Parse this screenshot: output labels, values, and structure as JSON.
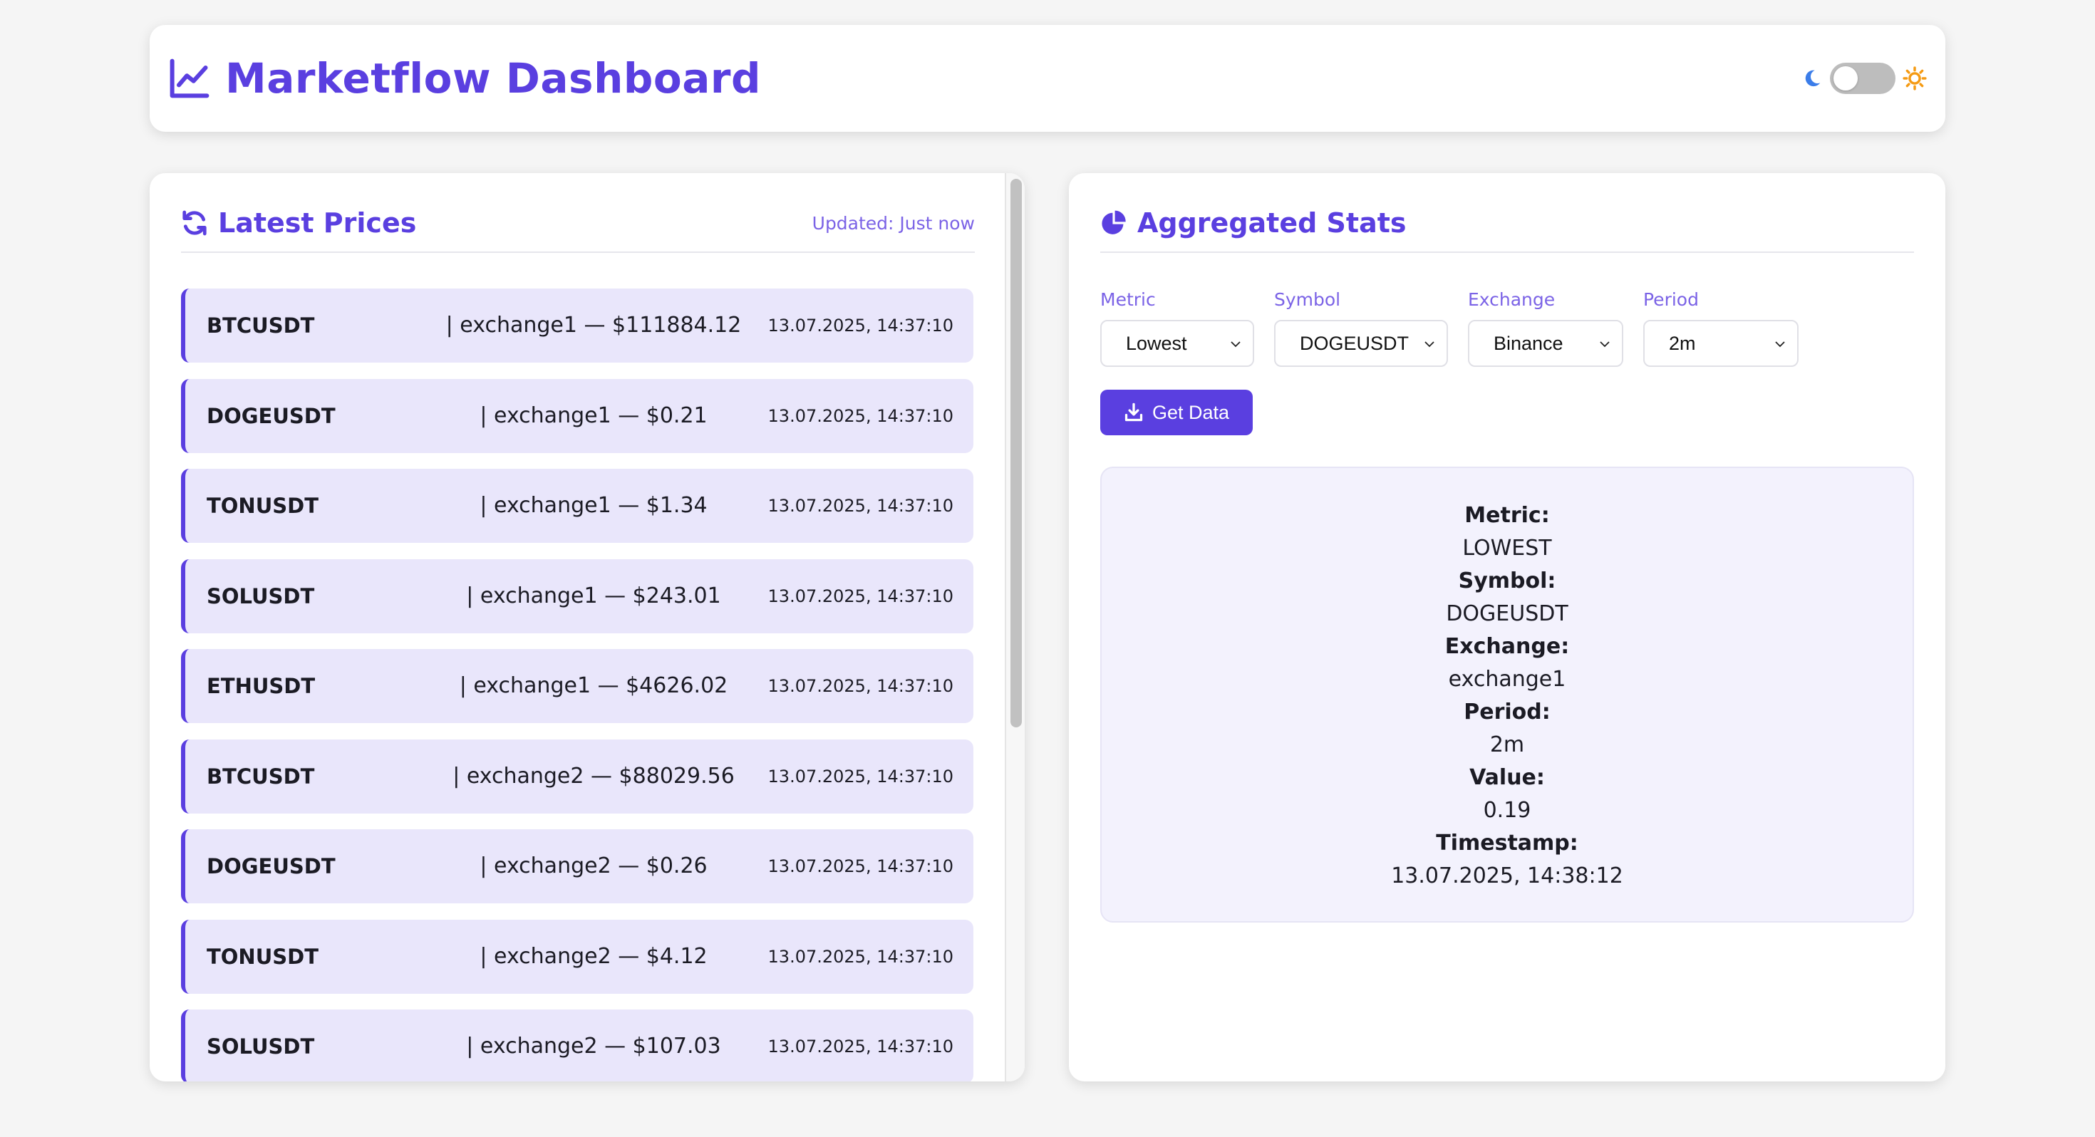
{
  "header": {
    "title": "Marketflow Dashboard",
    "title_icon": "chart-line-icon",
    "theme_toggle": {
      "state": "off",
      "left_icon": "moon-icon",
      "right_icon": "sun-icon"
    }
  },
  "colors": {
    "accent": "#5a3fe0",
    "accent_light": "#7b63e6",
    "row_bg": "#e9e6fb",
    "page_bg": "#f5f5f5",
    "sun": "#f59a12",
    "moon": "#3b7de9"
  },
  "latest_prices": {
    "title": "Latest Prices",
    "icon": "refresh-icon",
    "updated": "Updated: Just now",
    "rows": [
      {
        "symbol": "BTCUSDT",
        "info": "| exchange1 — $111884.12",
        "timestamp": "13.07.2025, 14:37:10"
      },
      {
        "symbol": "DOGEUSDT",
        "info": "| exchange1 — $0.21",
        "timestamp": "13.07.2025, 14:37:10"
      },
      {
        "symbol": "TONUSDT",
        "info": "| exchange1 — $1.34",
        "timestamp": "13.07.2025, 14:37:10"
      },
      {
        "symbol": "SOLUSDT",
        "info": "| exchange1 — $243.01",
        "timestamp": "13.07.2025, 14:37:10"
      },
      {
        "symbol": "ETHUSDT",
        "info": "| exchange1 — $4626.02",
        "timestamp": "13.07.2025, 14:37:10"
      },
      {
        "symbol": "BTCUSDT",
        "info": "| exchange2 — $88029.56",
        "timestamp": "13.07.2025, 14:37:10"
      },
      {
        "symbol": "DOGEUSDT",
        "info": "| exchange2 — $0.26",
        "timestamp": "13.07.2025, 14:37:10"
      },
      {
        "symbol": "TONUSDT",
        "info": "| exchange2 — $4.12",
        "timestamp": "13.07.2025, 14:37:10"
      },
      {
        "symbol": "SOLUSDT",
        "info": "| exchange2 — $107.03",
        "timestamp": "13.07.2025, 14:37:10"
      }
    ]
  },
  "aggregated": {
    "title": "Aggregated Stats",
    "icon": "pie-chart-icon",
    "filters": {
      "metric": {
        "label": "Metric",
        "value": "Lowest"
      },
      "symbol": {
        "label": "Symbol",
        "value": "DOGEUSDT"
      },
      "exchange": {
        "label": "Exchange",
        "value": "Binance"
      },
      "period": {
        "label": "Period",
        "value": "2m"
      }
    },
    "get_button": {
      "label": "Get Data",
      "icon": "download-icon"
    },
    "result": {
      "metric_label": "Metric:",
      "metric_value": "LOWEST",
      "symbol_label": "Symbol:",
      "symbol_value": "DOGEUSDT",
      "exchange_label": "Exchange:",
      "exchange_value": "exchange1",
      "period_label": "Period:",
      "period_value": "2m",
      "value_label": "Value:",
      "value_value": "0.19",
      "timestamp_label": "Timestamp:",
      "timestamp_value": "13.07.2025, 14:38:12"
    }
  }
}
